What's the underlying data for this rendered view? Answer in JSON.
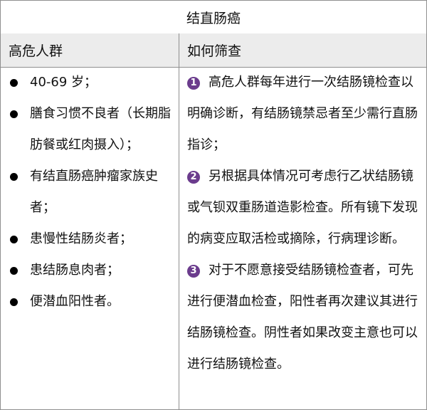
{
  "title": "结直肠癌",
  "headers": {
    "left": "高危人群",
    "right": "如何筛查"
  },
  "high_risk_groups": [
    "40-69 岁；",
    "膳食习惯不良者（长期脂肪餐或红肉摄入）；",
    "有结直肠癌肿瘤家族史者；",
    "患慢性结肠炎者；",
    "患结肠息肉者；",
    "便潜血阳性者。"
  ],
  "screening_methods": [
    {
      "number": "1",
      "text": "高危人群每年进行一次结肠镜检查以明确诊断，有结肠镜禁忌者至少需行直肠指诊；"
    },
    {
      "number": "2",
      "text": "另根据具体情况可考虑行乙状结肠镜或气钡双重肠道造影检查。所有镜下发现的病变应取活检或摘除，行病理诊断。"
    },
    {
      "number": "3",
      "text": "对于不愿意接受结肠镜检查者，可先进行便潜血检查，阳性者再次建议其进行结肠镜检查。阴性者如果改变主意也可以进行结肠镜检查。"
    }
  ]
}
